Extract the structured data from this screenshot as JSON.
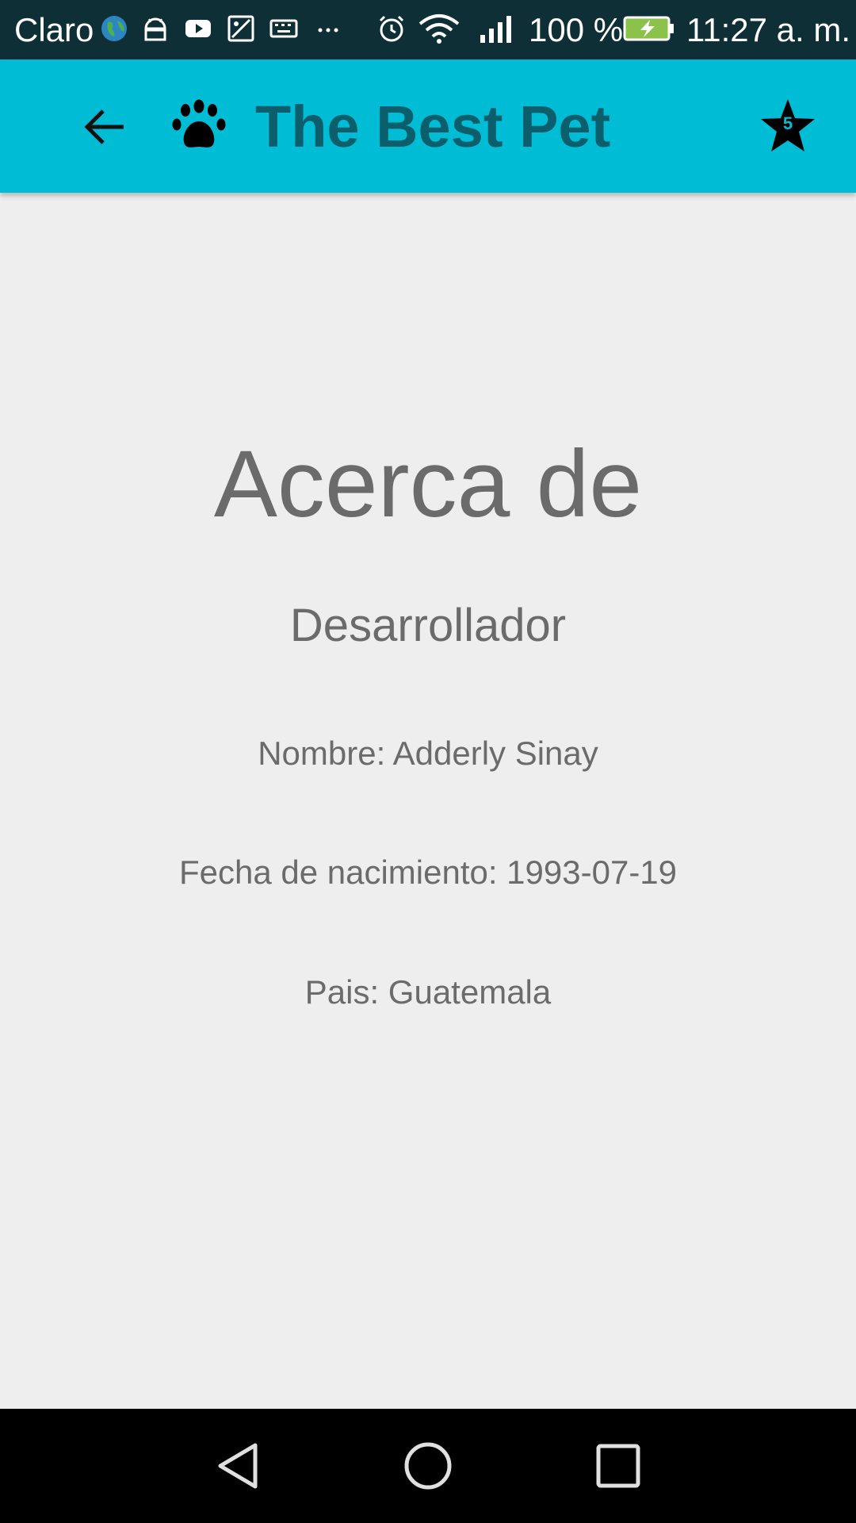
{
  "status_bar": {
    "carrier": "Claro",
    "battery_percent": "100 %",
    "time": "11:27 a. m.",
    "icons": [
      "globe-icon",
      "android-icon",
      "youtube-icon",
      "gallery-icon",
      "keyboard-icon",
      "more-icon",
      "alarm-icon",
      "wifi-icon",
      "signal-icon",
      "battery-charging-icon"
    ]
  },
  "app_bar": {
    "title": "The Best Pet",
    "rating_badge": "5",
    "background_color": "#00bcd4",
    "title_color": "#0b5f6d"
  },
  "content": {
    "title": "Acerca de",
    "subtitle": "Desarrollador",
    "name_line": "Nombre: Adderly Sinay",
    "birth_line": "Fecha de nacimiento: 1993-07-19",
    "country_line": "Pais: Guatemala",
    "text_color": "#6b6b6b"
  },
  "nav_bar": {
    "buttons": [
      "back-triangle-icon",
      "home-circle-icon",
      "recents-square-icon"
    ]
  }
}
